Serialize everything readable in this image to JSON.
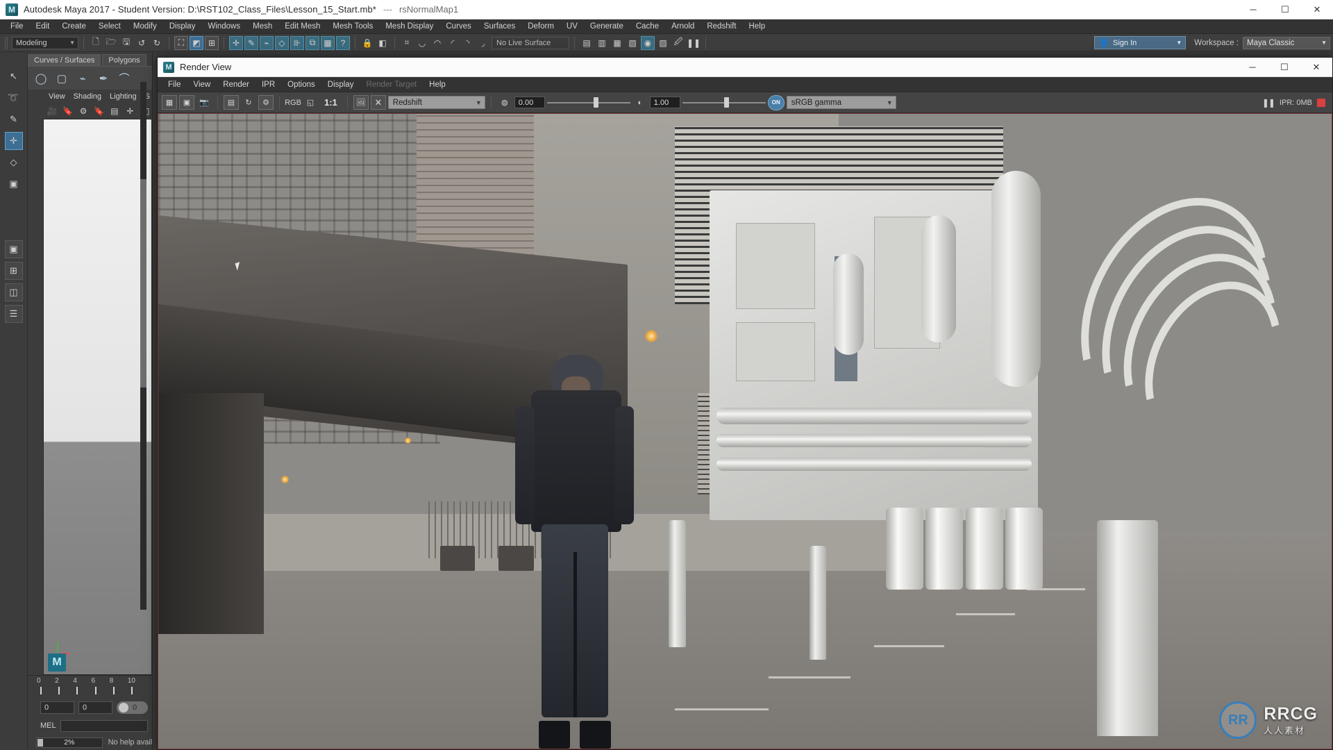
{
  "window": {
    "app_title": "Autodesk Maya 2017 - Student Version: D:\\RST102_Class_Files\\Lesson_15_Start.mb*",
    "title_separator": "---",
    "title_subobject": "rsNormalMap1",
    "icon": "maya-logo-icon",
    "controls": {
      "minimize": "─",
      "maximize": "☐",
      "close": "✕"
    }
  },
  "menu": {
    "items": [
      "File",
      "Edit",
      "Create",
      "Select",
      "Modify",
      "Display",
      "Windows",
      "Mesh",
      "Edit Mesh",
      "Mesh Tools",
      "Mesh Display",
      "Curves",
      "Surfaces",
      "Deform",
      "UV",
      "Generate",
      "Cache",
      "Arnold",
      "Redshift",
      "Help"
    ]
  },
  "statusline": {
    "mode": "Modeling",
    "live_surface": "No Live Surface",
    "sign_in": "Sign In",
    "workspace_label": "Workspace :",
    "workspace_value": "Maya Classic",
    "icons": [
      "new-scene-icon",
      "open-scene-icon",
      "save-scene-icon",
      "undo-icon",
      "redo-icon",
      "select-hierarchy-icon",
      "select-object-icon",
      "select-component-icon",
      "move-tool-icon",
      "rotate-tool-icon",
      "scale-tool-icon",
      "soft-select-icon",
      "symmetry-icon",
      "snap-grid-icon",
      "snap-curve-icon",
      "snap-point-icon",
      "snap-projected-icon",
      "snap-view-icon",
      "lock-icon",
      "render-current-frame-icon",
      "ipr-render-icon",
      "render-settings-icon",
      "hypershade-icon",
      "pause-icon"
    ]
  },
  "toolbox": {
    "items": [
      {
        "name": "select-tool",
        "glyph": "↖"
      },
      {
        "name": "lasso-select-tool",
        "glyph": "➰"
      },
      {
        "name": "paint-select-tool",
        "glyph": "✎"
      },
      {
        "name": "move-tool",
        "glyph": "✛"
      },
      {
        "name": "rotate-tool",
        "glyph": "◇"
      },
      {
        "name": "scale-tool",
        "glyph": "▣"
      },
      {
        "name": "single-perspective-layout",
        "glyph": "⬚"
      },
      {
        "name": "four-view-layout",
        "glyph": "⊞"
      },
      {
        "name": "two-pane-layout",
        "glyph": "◫"
      },
      {
        "name": "outliner-persp-layout",
        "glyph": "☰"
      }
    ]
  },
  "shelf": {
    "tabs": [
      {
        "label": "Curves / Surfaces",
        "active": true
      },
      {
        "label": "Polygons",
        "active": false
      }
    ],
    "buttons": [
      "nurbs-circle-icon",
      "nurbs-square-icon",
      "ep-curve-tool-icon",
      "pencil-curve-tool-icon",
      "bezier-curve-tool-icon"
    ]
  },
  "viewport_panel": {
    "menus": [
      "View",
      "Shading",
      "Lighting",
      "S"
    ],
    "tools": [
      "camera-icon",
      "camera-bookmark-icon",
      "camera-attributes-icon",
      "bookmark-icon",
      "grid-icon",
      "wireframe-icon",
      "smooth-shade-icon"
    ],
    "logo": "maya-watermark-icon"
  },
  "timeline": {
    "ticks": [
      "0",
      "2",
      "4",
      "6",
      "8",
      "10"
    ],
    "start_field": "0",
    "end_field": "0",
    "current_field": "0"
  },
  "command_line": {
    "label": "MEL",
    "value": ""
  },
  "status_bar": {
    "progress_percent": "2%",
    "help_text": "No help availab"
  },
  "render_view": {
    "title": "Render View",
    "icon": "maya-logo-icon",
    "controls": {
      "minimize": "─",
      "maximize": "☐",
      "close": "✕"
    },
    "menu": [
      {
        "label": "File",
        "disabled": false
      },
      {
        "label": "View",
        "disabled": false
      },
      {
        "label": "Render",
        "disabled": false
      },
      {
        "label": "IPR",
        "disabled": false
      },
      {
        "label": "Options",
        "disabled": false
      },
      {
        "label": "Display",
        "disabled": false
      },
      {
        "label": "Render Target",
        "disabled": true
      },
      {
        "label": "Help",
        "disabled": false
      }
    ],
    "toolbar": {
      "icons": [
        "redo-render-icon",
        "render-region-icon",
        "snapshot-icon",
        "ipr-render-icon",
        "refresh-ipr-icon",
        "render-settings-icon",
        "rgb-channel-icon",
        "alpha-channel-icon"
      ],
      "ratio": "1:1",
      "keep_image_icon": "keep-image-icon",
      "remove-image-icon": "remove-image-icon",
      "renderer": "Redshift",
      "exposure_icon": "aperture-icon",
      "exposure_value": "0.00",
      "gamma_icon": "contrast-icon",
      "gamma_value": "1.00",
      "color_mgmt_toggle": "ON",
      "color_transform": "sRGB gamma",
      "ipr_pause_icon": "pause-icon",
      "ipr_status": "IPR: 0MB",
      "ipr_stop_icon": "stop-icon"
    }
  },
  "watermark": {
    "brand": "RRCG",
    "subtitle": "人人素材",
    "mark": "RR"
  },
  "colors": {
    "accent_blue": "#4a7fa8",
    "panel_bg": "#3c3c3c",
    "menu_bg": "#333333",
    "ipr_red": "#d94040",
    "render_border": "#7a3b3b"
  }
}
